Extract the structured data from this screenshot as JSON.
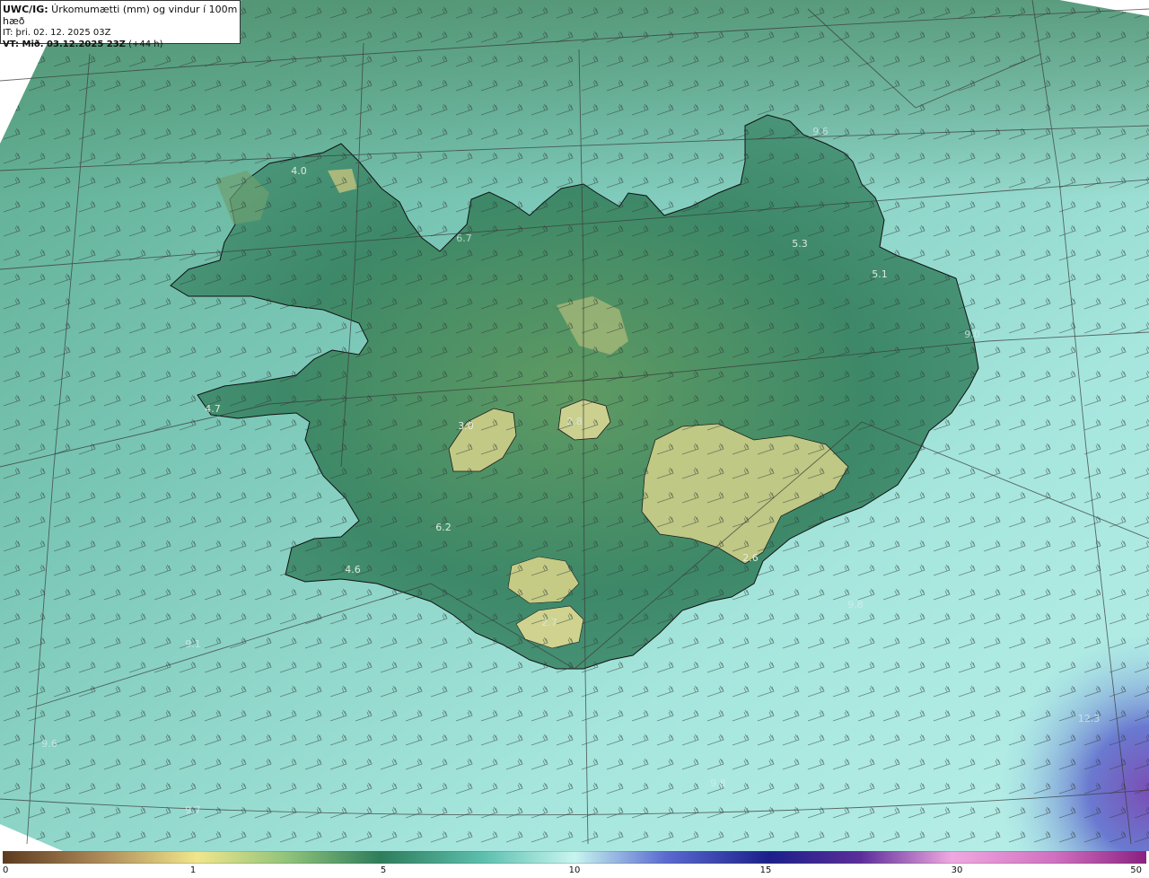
{
  "header": {
    "line1_bold": "UWC/IG:",
    "line1_rest": " Úrkomumætti (mm) og vindur í 100m hæð",
    "line2": "IT: þri. 02. 12. 2025 03Z",
    "line3_bold": "VT: Mið. 03.12.2025 23Z",
    "line3_rest": " (+44 h)"
  },
  "colorbar": {
    "ticks": [
      "0",
      "1",
      "5",
      "10",
      "15",
      "30",
      "50"
    ],
    "colors": [
      "#5c3a1e",
      "#9b7a45",
      "#d8cc7a",
      "#f0e68c",
      "#7fbf7f",
      "#2e7d5b",
      "#6fcfc0",
      "#c8f5f0",
      "#4b5fc8",
      "#1b1f8a",
      "#8a2d9a",
      "#f0a8e0",
      "#b0308c"
    ]
  },
  "map_values": [
    {
      "label": "4.0"
    },
    {
      "label": "9.6"
    },
    {
      "label": "6.7"
    },
    {
      "label": "5.3"
    },
    {
      "label": "5.1"
    },
    {
      "label": "9.0"
    },
    {
      "label": "4.7"
    },
    {
      "label": "3.0"
    },
    {
      "label": "2.8"
    },
    {
      "label": "6.2"
    },
    {
      "label": "4.6"
    },
    {
      "label": "2.6"
    },
    {
      "label": "9.8"
    },
    {
      "label": "2.7"
    },
    {
      "label": "9.1"
    },
    {
      "label": "12.3"
    },
    {
      "label": "9.6"
    },
    {
      "label": "9.8"
    },
    {
      "label": "9.7"
    }
  ],
  "colors": {
    "sea": "#8fd8cf",
    "land": "#3f8a68",
    "highland": "#c9cf86",
    "coast": "#111111",
    "barb": "#333333",
    "heavy_precip": "#6a7ad0"
  }
}
